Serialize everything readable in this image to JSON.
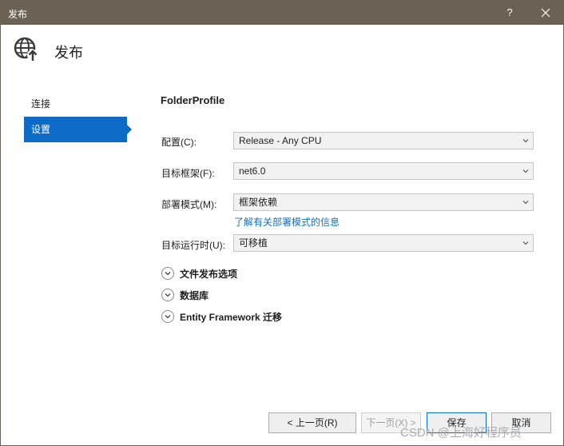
{
  "window": {
    "title": "发布",
    "help": "?"
  },
  "header": {
    "title": "发布"
  },
  "nav": {
    "items": [
      {
        "label": "连接"
      },
      {
        "label": "设置"
      }
    ]
  },
  "profile": {
    "name": "FolderProfile"
  },
  "fields": {
    "config": {
      "label": "配置(C):",
      "value": "Release - Any CPU"
    },
    "framework": {
      "label": "目标框架(F):",
      "value": "net6.0"
    },
    "deploy": {
      "label": "部署模式(M):",
      "value": "框架依赖",
      "link": "了解有关部署模式的信息"
    },
    "runtime": {
      "label": "目标运行时(U):",
      "value": "可移植"
    }
  },
  "sections": [
    {
      "label": "文件发布选项"
    },
    {
      "label": "数据库"
    },
    {
      "label": "Entity Framework 迁移"
    }
  ],
  "buttons": {
    "prev": "< 上一页(R)",
    "next": "下一页(X) >",
    "save": "保存",
    "cancel": "取消"
  },
  "watermark": "CSDN @上海好程序员",
  "colors": {
    "titlebar": "#6b6255",
    "accent": "#0e6ac7",
    "link": "#1a6fb5"
  }
}
